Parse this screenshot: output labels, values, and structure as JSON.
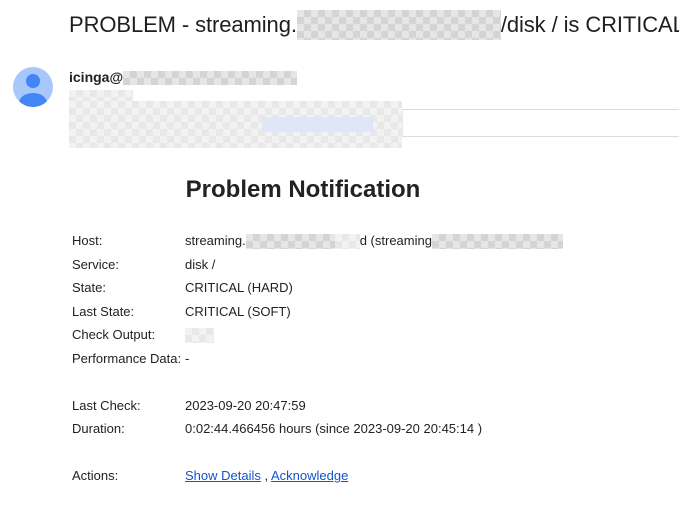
{
  "email": {
    "subject_prefix": "PROBLEM - streaming.",
    "subject_suffix": "/disk / is CRITICAL",
    "sender_prefix": "icinga@"
  },
  "notification": {
    "title": "Problem Notification",
    "rows": {
      "host": {
        "label": "Host:",
        "value_prefix": "streaming.",
        "value_mid": "d (streaming"
      },
      "service": {
        "label": "Service:",
        "value": "disk /"
      },
      "state": {
        "label": "State:",
        "value": "CRITICAL (HARD)"
      },
      "last_state": {
        "label": "Last State:",
        "value": "CRITICAL (SOFT)"
      },
      "check_output": {
        "label": "Check Output:"
      },
      "perf_data": {
        "label": "Performance Data:",
        "value": "-"
      },
      "last_check": {
        "label": "Last Check:",
        "value": "2023-09-20 20:47:59"
      },
      "duration": {
        "label": "Duration:",
        "value": "0:02:44.466456 hours (since 2023-09-20 20:45:14 )"
      },
      "actions": {
        "label": "Actions:",
        "show_details": "Show Details",
        "separator": " , ",
        "acknowledge": "Acknowledge"
      }
    }
  },
  "colors": {
    "link": "#1155cc",
    "avatar_bg": "#a8c7fa",
    "avatar_fg": "#4285f4"
  },
  "icons": {
    "avatar": "person-icon"
  }
}
